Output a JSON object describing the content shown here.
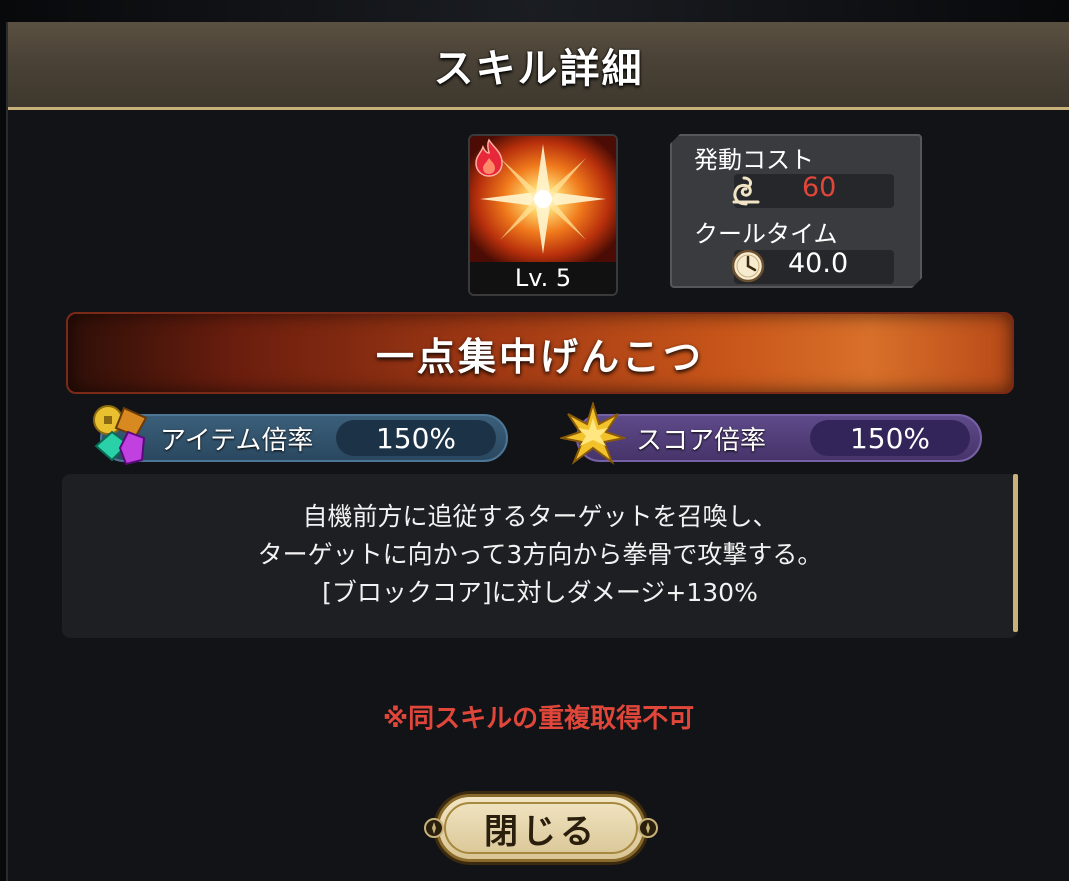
{
  "dialog": {
    "title": "スキル詳細"
  },
  "skill": {
    "name": "一点集中げんこつ",
    "level_label": "Lv. 5",
    "element_icon": "fire-icon"
  },
  "cost": {
    "activation_label": "発動コスト",
    "activation_value": "60",
    "activation_icon": "swirl-icon",
    "cooldown_label": "クールタイム",
    "cooldown_value": "40.0",
    "cooldown_icon": "clock-icon"
  },
  "multipliers": {
    "item_label": "アイテム倍率",
    "item_value": "150%",
    "item_icon": "gems-coins-icon",
    "score_label": "スコア倍率",
    "score_value": "150%",
    "score_icon": "star-icon"
  },
  "description": {
    "lines": [
      "自機前方に追従するターゲットを召喚し、",
      "ターゲットに向かって3方向から拳骨で攻撃する。",
      "[ブロックコア]に対しダメージ+130%"
    ]
  },
  "notice": "※同スキルの重複取得不可",
  "close_button": "閉じる",
  "colors": {
    "header_border": "#c8b27a",
    "cost_value": "#e0473a",
    "notice": "#e0473a",
    "item_pill": "#3b5f7a",
    "score_pill": "#5f4a8a"
  }
}
